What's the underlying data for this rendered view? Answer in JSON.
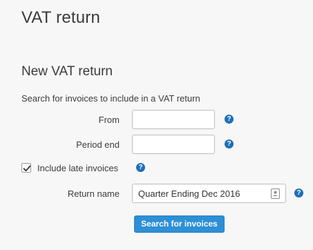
{
  "page": {
    "title": "VAT return"
  },
  "section": {
    "title": "New VAT return",
    "intro": "Search for invoices to include in a VAT return"
  },
  "form": {
    "from": {
      "label": "From",
      "value": ""
    },
    "period_end": {
      "label": "Period end",
      "value": ""
    },
    "include_late": {
      "label": "Include late invoices",
      "checked": true
    },
    "return_name": {
      "label": "Return name",
      "value": "Quarter Ending Dec 2016"
    },
    "help_glyph": "?",
    "help_icon": "question-circle-icon",
    "accent_color": "#1d6fb8"
  },
  "actions": {
    "search_label": "Search for invoices",
    "button_color": "#2d8fd6"
  }
}
